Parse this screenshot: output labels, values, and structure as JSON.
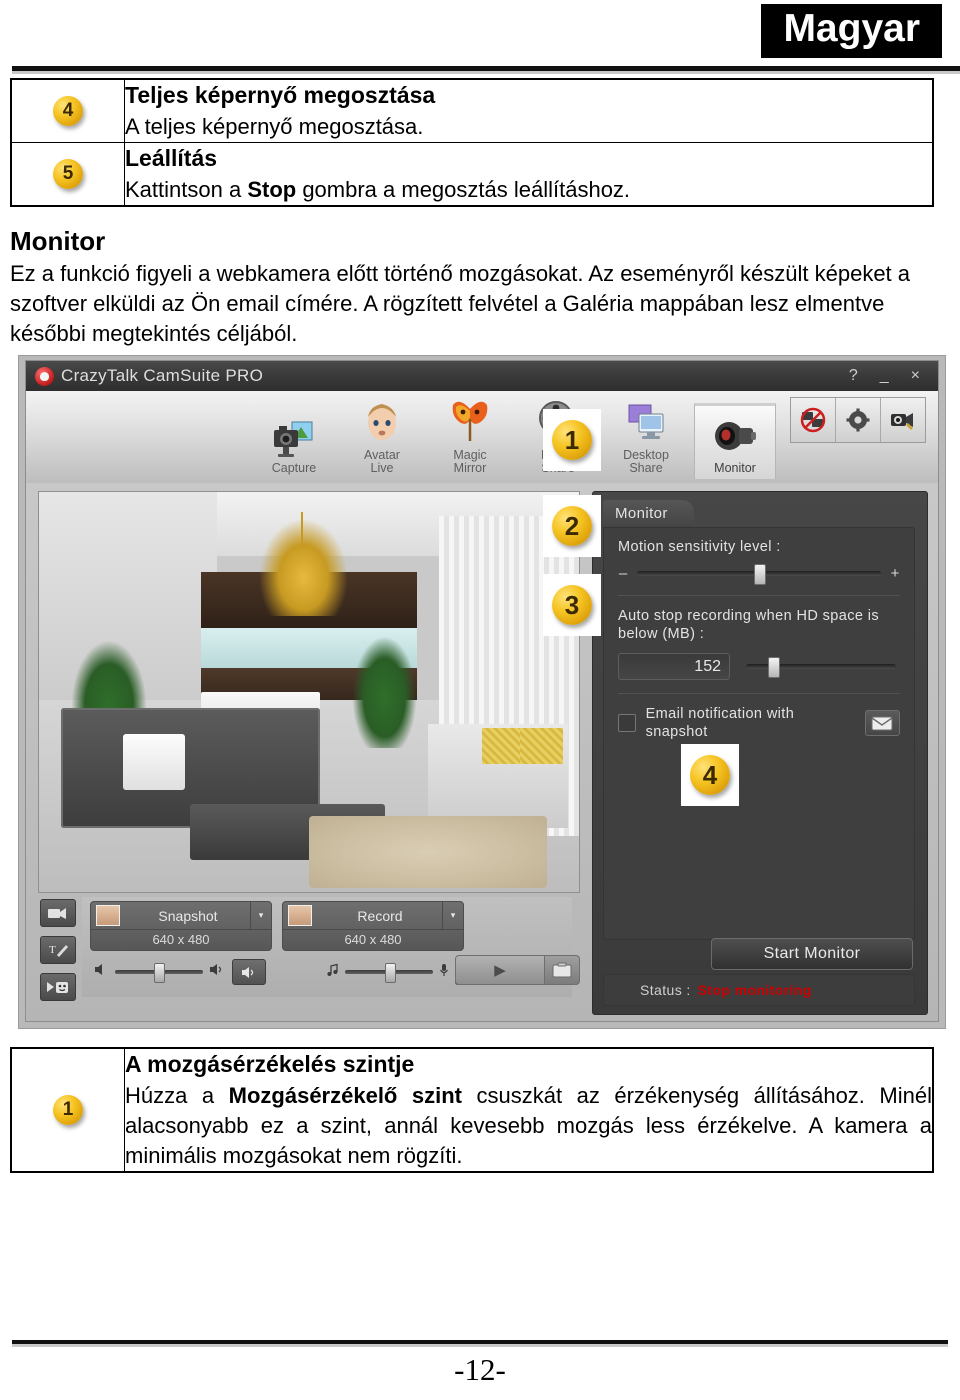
{
  "header": {
    "language_banner": "Magyar"
  },
  "top_table": {
    "rows": [
      {
        "number": "4",
        "title": "Teljes képernyő megosztása",
        "desc_plain": "A teljes képernyő megosztása."
      },
      {
        "number": "5",
        "title": "Leállítás",
        "desc_before": "Kattintson a ",
        "desc_bold": "Stop",
        "desc_after": " gombra a megosztás leállításhoz."
      }
    ]
  },
  "monitor_section": {
    "heading": "Monitor",
    "paragraph": "Ez a funkció figyeli a webkamera előtt történő mozgásokat. Az eseményről készült képeket a szoftver elküldi az Ön email címére. A rögzített felvétel a Galéria mappában lesz elmentve későbbi megtekintés céljából."
  },
  "app": {
    "titlebar": {
      "title": "CrazyTalk CamSuite PRO",
      "logo_icon": "shield-logo-icon",
      "help": "?",
      "minimize": "_",
      "close": "×"
    },
    "toolbar": {
      "items": [
        {
          "label_line1": "Capture",
          "label_line2": "",
          "icon": "camera-photo-icon",
          "active": false
        },
        {
          "label_line1": "Avatar",
          "label_line2": "Live",
          "icon": "avatar-face-icon",
          "active": false
        },
        {
          "label_line1": "Magic",
          "label_line2": "Mirror",
          "icon": "carnival-mask-icon",
          "active": false
        },
        {
          "label_line1": "Media",
          "label_line2": "Share",
          "icon": "film-reel-icon",
          "active": false
        },
        {
          "label_line1": "Desktop",
          "label_line2": "Share",
          "icon": "desktop-monitor-icon",
          "active": false
        },
        {
          "label_line1": "Monitor",
          "label_line2": "",
          "icon": "webcam-monitor-icon",
          "active": true
        }
      ],
      "right_buttons": [
        {
          "icon": "disable-sharing-icon"
        },
        {
          "icon": "gear-icon"
        },
        {
          "icon": "camera-settings-icon"
        }
      ]
    },
    "left_strip": [
      {
        "icon": "video-effect-icon"
      },
      {
        "icon": "text-pen-icon"
      },
      {
        "icon": "emoticon-icon"
      }
    ],
    "capture": {
      "snapshot": {
        "label": "Snapshot",
        "resolution": "640 x 480",
        "icon": "snapshot-thumb-icon",
        "arrow": "▾"
      },
      "record": {
        "label": "Record",
        "resolution": "640 x 480",
        "icon": "record-thumb-icon",
        "arrow": "▾"
      },
      "speaker_icon": "speaker-icon",
      "speaker_low_icon": "speaker-low-icon",
      "speaker_button_icon": "speaker-button-icon",
      "music_icon": "music-note-icon",
      "mic_icon": "microphone-icon",
      "mixer_button_icon": "audio-mixer-icon",
      "play_icon": "▶",
      "folder_icon": "folder-icon"
    },
    "settings_panel": {
      "tab_label": "Monitor",
      "motion_label": "Motion sensitivity level :",
      "motion_minus": "–",
      "motion_plus": "+",
      "motion_value_pct": 50,
      "autostop_label_line1": "Auto stop recording when HD space is",
      "autostop_label_line2": "below (MB) :",
      "autostop_value": "152",
      "autostop_slider_pct": 18,
      "email_label": "Email notification with snapshot",
      "email_checked": false,
      "email_button_icon": "envelope-icon",
      "start_button": "Start Monitor",
      "status_label": "Status :",
      "status_value": "Stop monitoring",
      "status_color": "#cc0000"
    },
    "callouts": [
      {
        "number": "1"
      },
      {
        "number": "2"
      },
      {
        "number": "3"
      },
      {
        "number": "4"
      }
    ]
  },
  "bottom_table": {
    "rows": [
      {
        "number": "1",
        "title": "A mozgásérzékelés szintje",
        "desc_before": "Húzza a ",
        "desc_bold": "Mozgásérzékelő szint",
        "desc_after": " csuszkát az érzékenység állításához. Minél alacsonyabb ez a szint, annál kevesebb mozgás less érzékelve. A kamera a minimális mozgásokat nem rögzíti."
      }
    ]
  },
  "footer": {
    "page_number": "-12-"
  },
  "colors": {
    "badge_gold": "#f6c524",
    "banner_black": "#000000",
    "status_red": "#cc0000"
  }
}
